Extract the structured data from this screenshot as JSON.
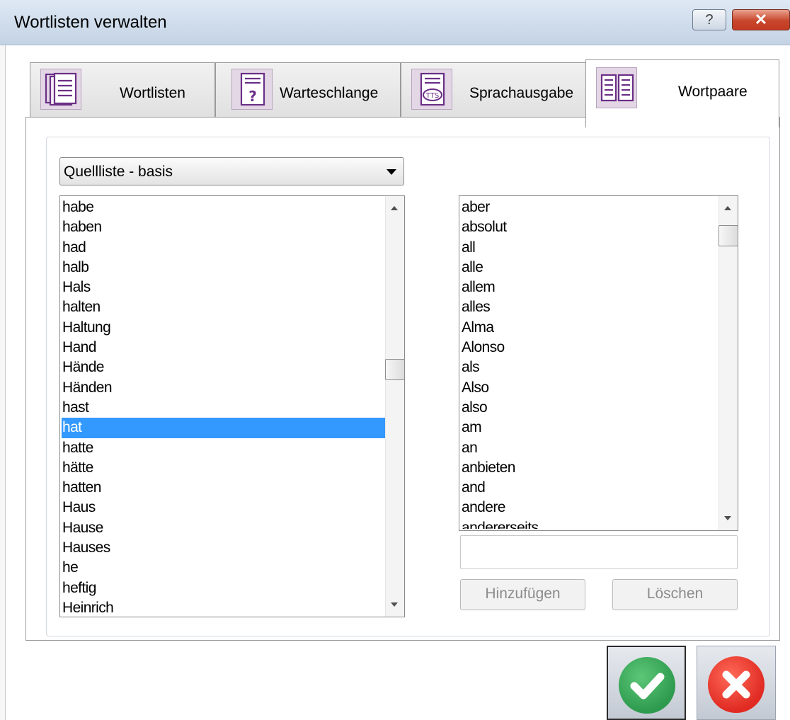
{
  "window": {
    "title": "Wortlisten verwalten",
    "help_label": "?",
    "close_label": "✕"
  },
  "tabs": [
    {
      "label": "Wortlisten",
      "icon": "document-stack-icon",
      "active": false
    },
    {
      "label": "Warteschlange",
      "icon": "question-document-icon",
      "active": false
    },
    {
      "label": "Sprachausgabe",
      "icon": "tts-icon",
      "active": false
    },
    {
      "label": "Wortpaare",
      "icon": "two-columns-icon",
      "active": true
    }
  ],
  "source_select": {
    "value": "Quellliste - basis"
  },
  "source_list": {
    "items": [
      "habe",
      "haben",
      "had",
      "halb",
      "Hals",
      "halten",
      "Haltung",
      "Hand",
      "Hände",
      "Händen",
      "hast",
      "hat",
      "hatte",
      "hätte",
      "hatten",
      "Haus",
      "Hause",
      "Hauses",
      "he",
      "heftig",
      "Heinrich"
    ],
    "selected": "hat"
  },
  "pair_list": {
    "items": [
      "aber",
      "absolut",
      "all",
      "alle",
      "allem",
      "alles",
      "Alma",
      "Alonso",
      "als",
      "Also",
      "also",
      "am",
      "an",
      "anbieten",
      "and",
      "andere",
      "andererseits"
    ]
  },
  "word_input": {
    "value": ""
  },
  "buttons": {
    "add_label": "Hinzufügen",
    "delete_label": "Löschen",
    "ok_icon": "checkmark-icon",
    "cancel_icon": "cross-icon"
  },
  "colors": {
    "selection": "#3399ff",
    "tab_icon_bg": "#e3d7e6",
    "icon_stroke": "#6b2f86",
    "ok_green": "#2e9a4e",
    "cancel_red": "#e02a22"
  }
}
